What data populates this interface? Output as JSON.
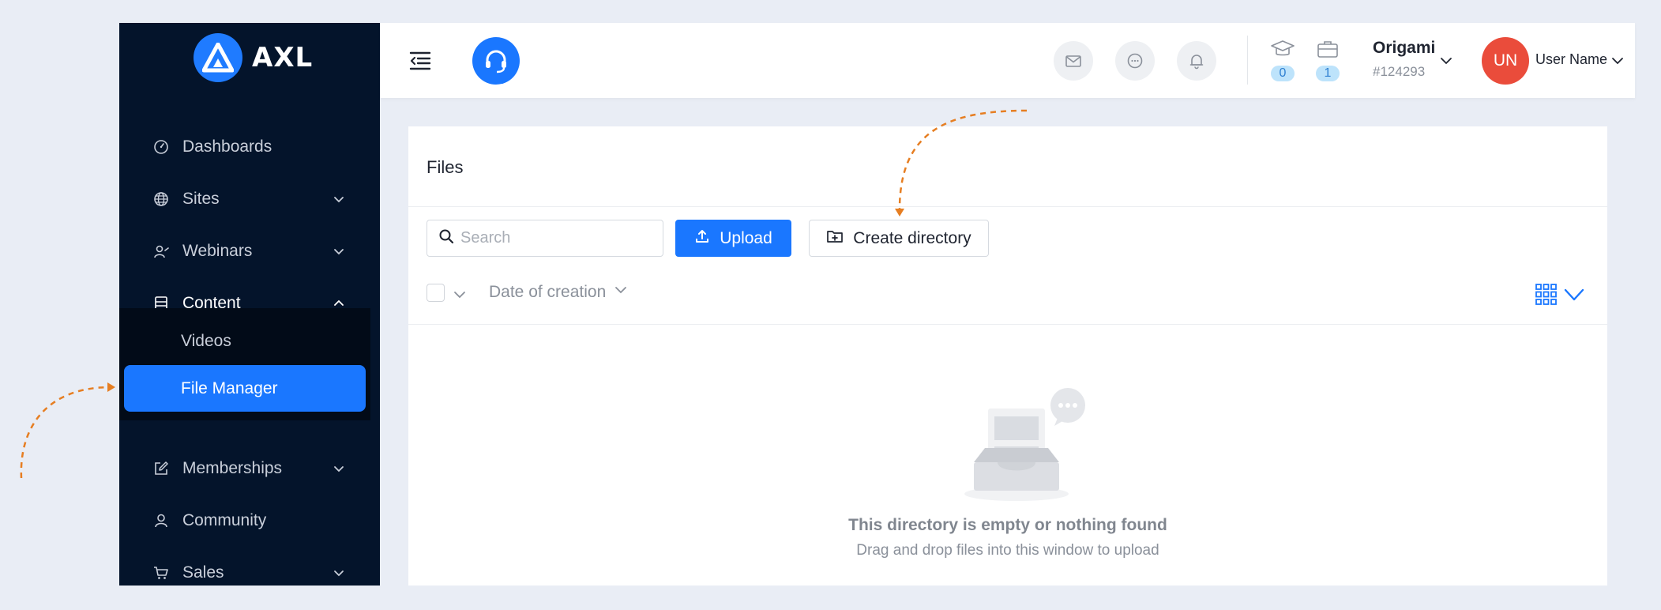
{
  "brand": {
    "name": "AXL",
    "accent": "#1a77ff",
    "sidebar_bg": "#04142b"
  },
  "sidebar": {
    "items": [
      {
        "label": "Dashboards",
        "icon": "gauge-icon"
      },
      {
        "label": "Sites",
        "icon": "globe-icon"
      },
      {
        "label": "Webinars",
        "icon": "webinar-icon"
      },
      {
        "label": "Content",
        "icon": "content-icon"
      },
      {
        "label": "Memberships",
        "icon": "edit-icon"
      },
      {
        "label": "Community",
        "icon": "user-icon"
      },
      {
        "label": "Sales",
        "icon": "cart-icon"
      }
    ],
    "content_sub": [
      {
        "label": "Videos"
      },
      {
        "label": "File Manager"
      }
    ]
  },
  "header": {
    "counters": [
      {
        "icon": "graduation-cap-icon",
        "value": "0"
      },
      {
        "icon": "briefcase-icon",
        "value": "1"
      }
    ],
    "account": {
      "name": "Origami",
      "id": "#124293"
    },
    "user": {
      "initials": "UN",
      "name": "User Name",
      "avatar_color": "#ea4c3b"
    }
  },
  "files": {
    "title": "Files",
    "search_placeholder": "Search",
    "upload_label": "Upload",
    "create_dir_label": "Create directory",
    "sort_label": "Date of creation",
    "empty_title": "This directory is empty or nothing found",
    "empty_subtitle": "Drag and drop files into this window to upload"
  }
}
